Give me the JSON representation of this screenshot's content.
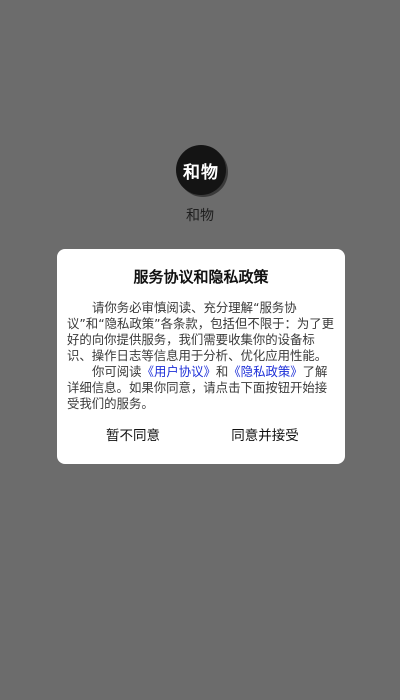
{
  "app": {
    "logo_text": "和物",
    "name": "和物"
  },
  "dialog": {
    "title": "服务协议和隐私政策",
    "paragraph1": "请你务必审慎阅读、充分理解“服务协议”和“隐私政策”各条款，包括但不限于：为了更好的向你提供服务，我们需要收集你的设备标识、操作日志等信息用于分析、优化应用性能。",
    "paragraph2_prefix": "你可阅读",
    "user_agreement_link": "《用户协议》",
    "conjunction": "和",
    "privacy_policy_link": "《隐私政策》",
    "paragraph2_suffix": "了解详细信息。如果你同意，请点击下面按钮开始接受我们的服务。",
    "decline_label": "暂不同意",
    "accept_label": "同意并接受"
  },
  "colors": {
    "overlay": "#6c6c6c",
    "link": "#1d2fd8",
    "dialog_bg": "#ffffff"
  }
}
